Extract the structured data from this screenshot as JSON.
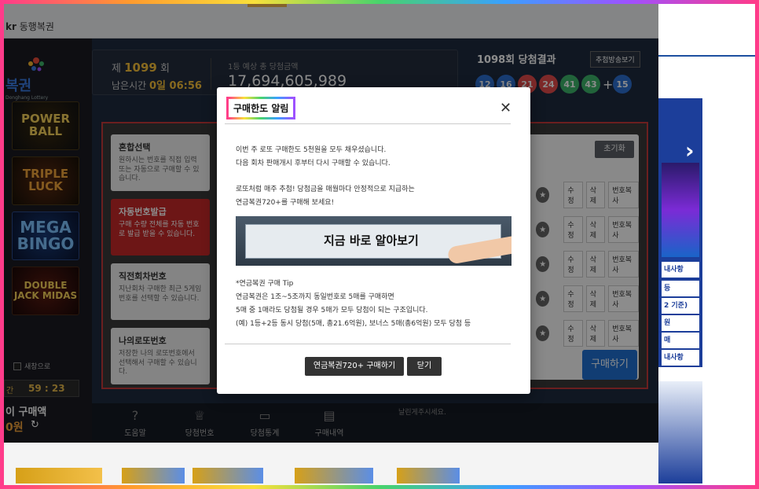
{
  "browser": {
    "url_prefix": "kr",
    "page_title": "동행복권"
  },
  "logo": {
    "name": "복권",
    "sub": "Donghang Lottery"
  },
  "games": [
    "POWER BALL",
    "TRIPLE LUCK",
    "MEGA BINGO",
    "DOUBLE JACK MIDAS"
  ],
  "left": {
    "autosave": "새창으로",
    "timer_label": "간",
    "timer": "59 : 23",
    "limit_label": "이 구매액",
    "limit_amount": "0원"
  },
  "round_info": {
    "round_prefix": "제",
    "round": "1099",
    "round_suffix": "회",
    "remain_label": "남은시간",
    "remain_value": "0일 06:56",
    "prize_label": "1등 예상 총 당첨금액",
    "prize_value": "17,694,605,989"
  },
  "result": {
    "title": "1098회 당첨결과",
    "broadcast_button": "추첨방송보기",
    "balls": [
      {
        "n": "12",
        "color": "#2d6fd2"
      },
      {
        "n": "16",
        "color": "#2d6fd2"
      },
      {
        "n": "21",
        "color": "#e34b4b"
      },
      {
        "n": "24",
        "color": "#e34b4b"
      },
      {
        "n": "41",
        "color": "#3cb46a"
      },
      {
        "n": "43",
        "color": "#3cb46a"
      }
    ],
    "plus": "+",
    "bonus": {
      "n": "15",
      "color": "#2d6fd2"
    }
  },
  "tabs": [
    {
      "title": "혼합선택",
      "desc": "원하시는 번호를 직접 입력 또는 자동으로 구매할 수 있습니다."
    },
    {
      "title": "자동번호발급",
      "desc": "구매 수량 전체를 자동 번호로 발급 받을 수 있습니다."
    },
    {
      "title": "직전회차번호",
      "desc": "지난회차 구매한 최근 5게임 번호를 선택할 수 있습니다."
    },
    {
      "title": "나의로또번호",
      "desc": "저장한 나의 로또번호에서 선택해서 구매할 수 있습니다."
    }
  ],
  "number_panel": {
    "reset": "초기화",
    "slot_buttons": [
      "수정",
      "삭제",
      "번호복사"
    ],
    "amount_label": "액",
    "amount": "0원",
    "buy": "구매하기"
  },
  "bottom_nav": {
    "items": [
      "도움말",
      "당첨번호",
      "당첨통계",
      "구매내역"
    ],
    "notice": "날린게주시세요."
  },
  "modal": {
    "title": "구매한도 알림",
    "close": "✕",
    "line1": "이번 주 로또 구매한도 5천원을 모두 채우셨습니다.",
    "line2": "다음 회차 판매개시 후부터 다시 구매할 수 있습니다.",
    "line3": "로또처럼 매주 추첨! 당첨금을 매월마다 안정적으로 지급하는",
    "line4": "연금복권720+를 구매해 보세요!",
    "banner_text": "지금 바로 알아보기",
    "tip_title": "*연금복권 구매 Tip",
    "tip1": "연금복권은 1조~5조까지 동일번호로 5매를 구매하면",
    "tip2": "5매 중 1매라도 당첨될 경우 5매가 모두 당첨이 되는 구조입니다.",
    "tip3": "(예) 1등+2등 동시 당첨(5매, 총21.6억원), 보너스 5매(총6억원) 모두 당첨 등",
    "buy_pension": "연금복권720+ 구매하기",
    "close_btn": "닫기"
  },
  "right_ad": {
    "cards": [
      "내사항",
      "등",
      "2 기준)",
      "원",
      "매",
      "내사항",
      "%"
    ]
  }
}
